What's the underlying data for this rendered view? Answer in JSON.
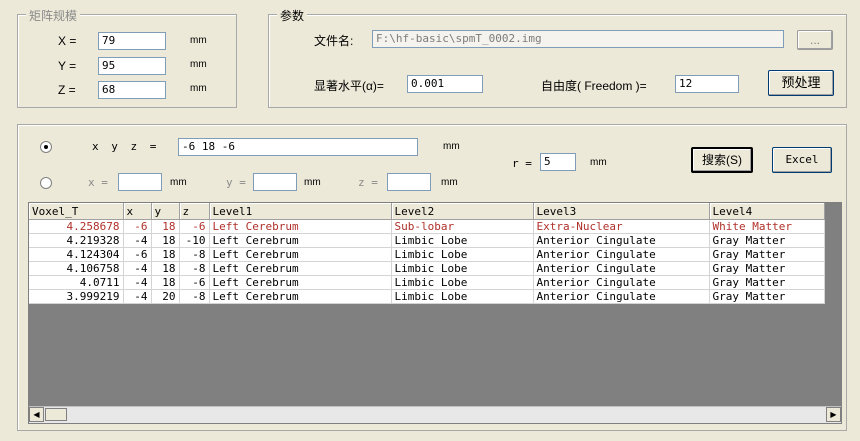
{
  "matrix": {
    "title": "矩阵规模",
    "x_label": "X =",
    "x_value": "79",
    "y_label": "Y =",
    "y_value": "95",
    "z_label": "Z =",
    "z_value": "68",
    "unit": "mm"
  },
  "params": {
    "title": "参数",
    "file_label": "文件名:",
    "file_value": "F:\\hf-basic\\spmT_0002.img",
    "browse_label": "...",
    "sig_label": "显著水平(α)=",
    "sig_value": "0.001",
    "freedom_label": "自由度( Freedom )=",
    "freedom_value": "12",
    "preprocess_label": "预处理"
  },
  "search": {
    "xyz_label": "x y z =",
    "xyz_value": "-6 18 -6",
    "unit": "mm",
    "x_label": "x =",
    "x_value": "",
    "y_label": "y =",
    "y_value": "",
    "z_label": "z =",
    "z_value": "",
    "r_label": "r =",
    "r_value": "5",
    "search_button": "搜索(S)",
    "excel_button": "Excel"
  },
  "table": {
    "headers": [
      "Voxel_T",
      "x",
      "y",
      "z",
      "Level1",
      "Level2",
      "Level3",
      "Level4"
    ],
    "rows": [
      [
        "4.258678",
        "-6",
        "18",
        "-6",
        "Left Cerebrum",
        "Sub-lobar",
        "Extra-Nuclear",
        "White Matter"
      ],
      [
        "4.219328",
        "-4",
        "18",
        "-10",
        "Left Cerebrum",
        "Limbic Lobe",
        "Anterior Cingulate",
        "Gray Matter"
      ],
      [
        "4.124304",
        "-6",
        "18",
        "-8",
        "Left Cerebrum",
        "Limbic Lobe",
        "Anterior Cingulate",
        "Gray Matter"
      ],
      [
        "4.106758",
        "-4",
        "18",
        "-8",
        "Left Cerebrum",
        "Limbic Lobe",
        "Anterior Cingulate",
        "Gray Matter"
      ],
      [
        "4.0711",
        "-4",
        "18",
        "-6",
        "Left Cerebrum",
        "Limbic Lobe",
        "Anterior Cingulate",
        "Gray Matter"
      ],
      [
        "3.999219",
        "-4",
        "20",
        "-8",
        "Left Cerebrum",
        "Limbic Lobe",
        "Anterior Cingulate",
        "Gray Matter"
      ]
    ]
  },
  "icons": {
    "scroll_left": "arrow-left-icon",
    "scroll_right": "arrow-right-icon"
  }
}
